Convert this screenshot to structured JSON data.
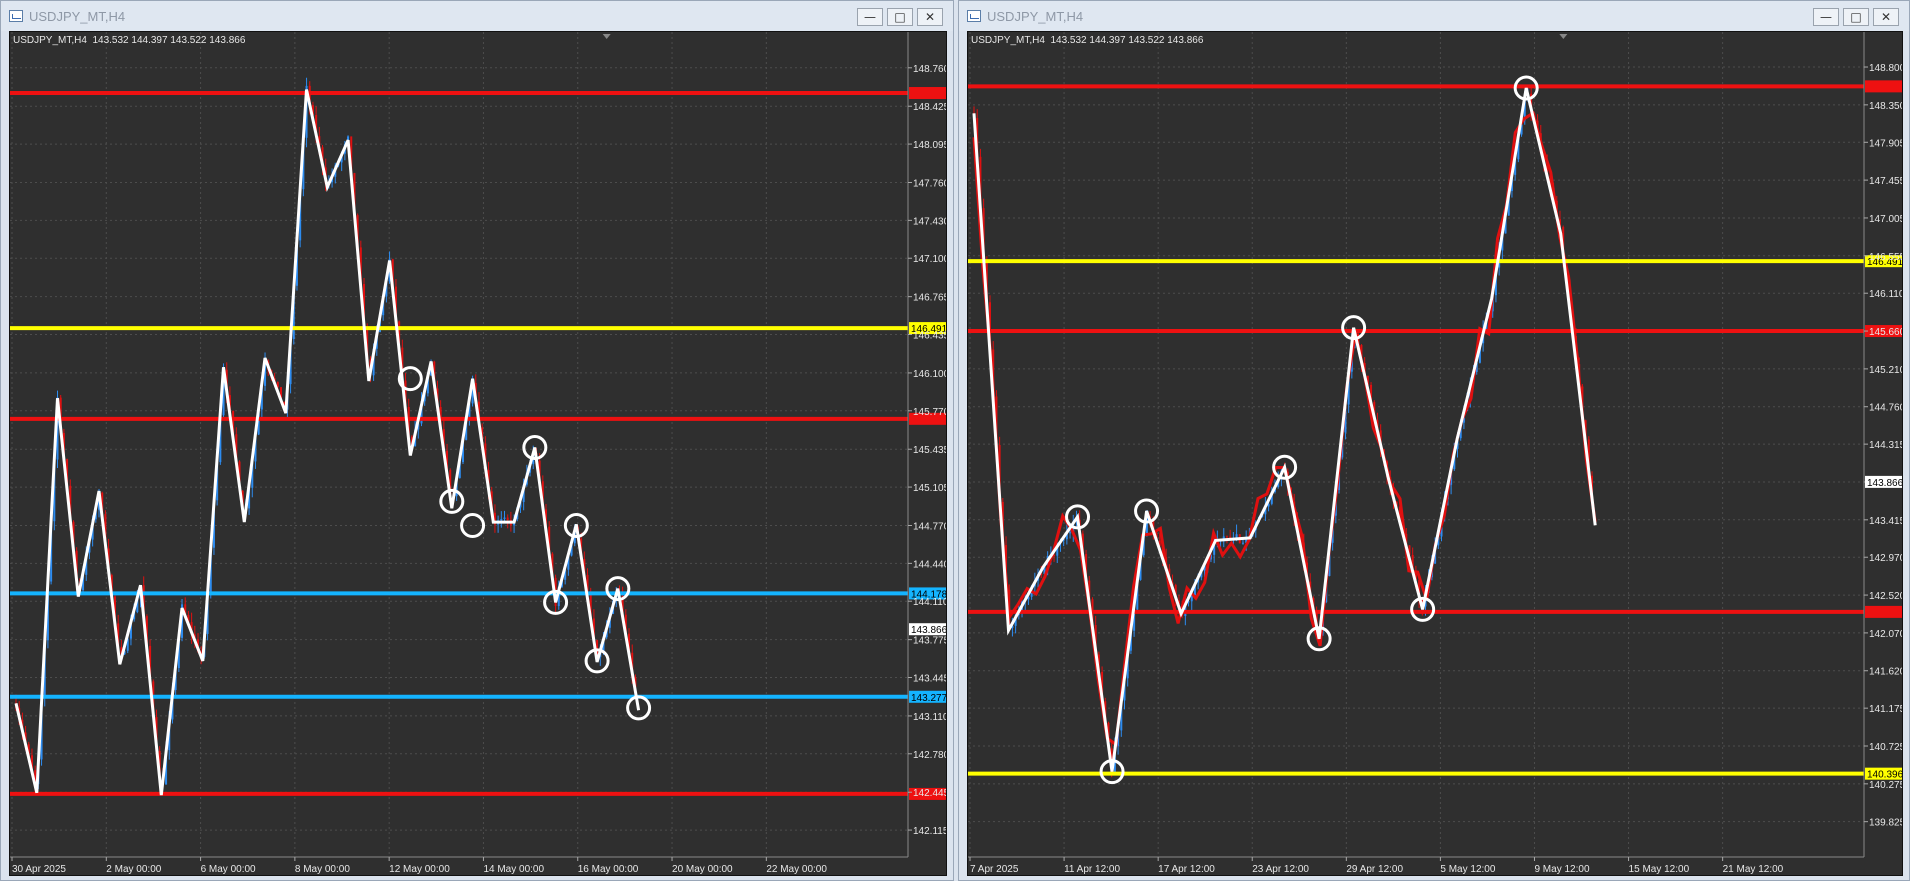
{
  "colors": {
    "bg": "#2f2f2f",
    "grid": "#4d4d4d",
    "red": "#ee1111",
    "yellow": "#ffff00",
    "blue": "#14b4ff",
    "white": "#ffffff",
    "up": "#2d8cf0",
    "down": "#e01010"
  },
  "windows": [
    {
      "title": "USDJPY_MT,H4",
      "info": "USDJPY_MT,H4  143.532 144.397 143.522 143.866",
      "buttons": {
        "minimize": "—",
        "restore": "□",
        "close": "✕"
      },
      "chart_data": {
        "type": "candlestick",
        "ylim": [
          141.95,
          148.95
        ],
        "y_ticks": [
          "148.760",
          "148.425",
          "148.095",
          "147.760",
          "147.430",
          "147.100",
          "146.765",
          "146.435",
          "146.100",
          "145.770",
          "145.435",
          "145.105",
          "144.770",
          "144.440",
          "144.110",
          "143.775",
          "143.445",
          "143.110",
          "142.780",
          "142.445",
          "142.115"
        ],
        "x_labels": [
          "30 Apr 2025",
          "2 May 00:00",
          "6 May 00:00",
          "8 May 00:00",
          "12 May 00:00",
          "14 May 00:00",
          "16 May 00:00",
          "20 May 00:00",
          "22 May 00:00"
        ],
        "current_price": "143.866",
        "levels": [
          {
            "price": 148.54,
            "color": "red",
            "label": ""
          },
          {
            "price": 146.491,
            "color": "yellow",
            "label": "146.491"
          },
          {
            "price": 145.7,
            "color": "red",
            "label": ""
          },
          {
            "price": 144.178,
            "color": "blue",
            "label": "144.178"
          },
          {
            "price": 143.277,
            "color": "blue",
            "label": "143.277"
          },
          {
            "price": 142.43,
            "color": "red",
            "label": ""
          }
        ],
        "zigzag_prices": [
          143.22,
          142.44,
          145.88,
          144.15,
          145.07,
          143.56,
          144.25,
          142.42,
          144.05,
          143.59,
          146.15,
          144.8,
          146.23,
          145.75,
          148.57,
          147.72,
          148.13,
          146.03,
          147.08,
          145.38,
          146.2,
          144.92,
          146.05,
          144.8,
          144.8,
          145.45,
          144.1,
          144.78,
          143.58,
          144.22,
          143.16
        ],
        "markers": [
          [
            19,
            146.05
          ],
          [
            21,
            144.98
          ],
          [
            22,
            144.77
          ],
          [
            25,
            145.45
          ],
          [
            26,
            144.1
          ],
          [
            27,
            144.77
          ],
          [
            28,
            143.59
          ],
          [
            29,
            144.22
          ],
          [
            30,
            143.18
          ]
        ],
        "seed": 7
      }
    },
    {
      "title": "USDJPY_MT,H4",
      "info": "USDJPY_MT,H4  143.532 144.397 143.522 143.866",
      "buttons": {
        "minimize": "—",
        "restore": "□",
        "close": "✕"
      },
      "chart_data": {
        "type": "candlestick",
        "ylim": [
          139.5,
          149.05
        ],
        "y_ticks": [
          "148.800",
          "148.350",
          "147.905",
          "147.455",
          "147.005",
          "146.555",
          "146.110",
          "145.660",
          "145.210",
          "144.760",
          "144.315",
          "143.865",
          "143.415",
          "142.970",
          "142.520",
          "142.070",
          "141.620",
          "141.175",
          "140.725",
          "140.275",
          "139.825"
        ],
        "x_labels": [
          "7 Apr 2025",
          "11 Apr 12:00",
          "17 Apr 12:00",
          "23 Apr 12:00",
          "29 Apr 12:00",
          "5 May 12:00",
          "9 May 12:00",
          "15 May 12:00",
          "21 May 12:00"
        ],
        "current_price": "143.866",
        "levels": [
          {
            "price": 148.57,
            "color": "red",
            "label": ""
          },
          {
            "price": 146.491,
            "color": "yellow",
            "label": "146.491"
          },
          {
            "price": 145.66,
            "color": "red",
            "label": ""
          },
          {
            "price": 142.32,
            "color": "red",
            "label": ""
          },
          {
            "price": 140.396,
            "color": "yellow",
            "label": "140.396"
          }
        ],
        "zigzag_prices": [
          148.25,
          142.1,
          142.85,
          143.45,
          140.42,
          143.52,
          142.3,
          143.17,
          143.2,
          144.04,
          142.0,
          145.7,
          143.92,
          142.35,
          144.38,
          146.05,
          148.55,
          146.82,
          143.35
        ],
        "markers": [
          [
            3,
            143.45
          ],
          [
            5,
            143.52
          ],
          [
            9,
            144.04
          ],
          [
            10,
            142.0
          ],
          [
            11,
            145.7
          ],
          [
            13,
            142.35
          ],
          [
            16,
            148.55
          ],
          [
            4,
            140.42
          ]
        ],
        "seed": 13
      }
    }
  ]
}
